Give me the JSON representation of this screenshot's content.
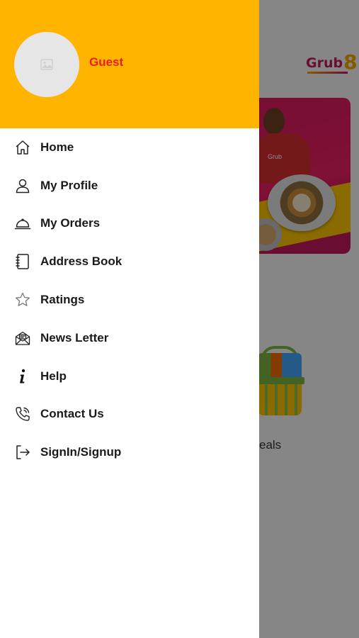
{
  "background": {
    "logo_text": "Grub",
    "logo_digit": "8",
    "banner_shirt_text": "Grub",
    "caption_fragment": "eals"
  },
  "drawer": {
    "user_name": "Guest",
    "avatar_icon": "image-placeholder-icon",
    "header_color": "#FFB400",
    "name_color": "#E8201C",
    "items": [
      {
        "label": "Home",
        "icon": "home-icon"
      },
      {
        "label": "My Profile",
        "icon": "user-icon"
      },
      {
        "label": "My Orders",
        "icon": "cloche-icon"
      },
      {
        "label": "Address Book",
        "icon": "address-book-icon"
      },
      {
        "label": "Ratings",
        "icon": "star-icon"
      },
      {
        "label": "News Letter",
        "icon": "newsletter-icon"
      },
      {
        "label": "Help",
        "icon": "info-icon"
      },
      {
        "label": "Contact Us",
        "icon": "phone-icon"
      },
      {
        "label": "SignIn/Signup",
        "icon": "sign-in-icon"
      }
    ]
  }
}
